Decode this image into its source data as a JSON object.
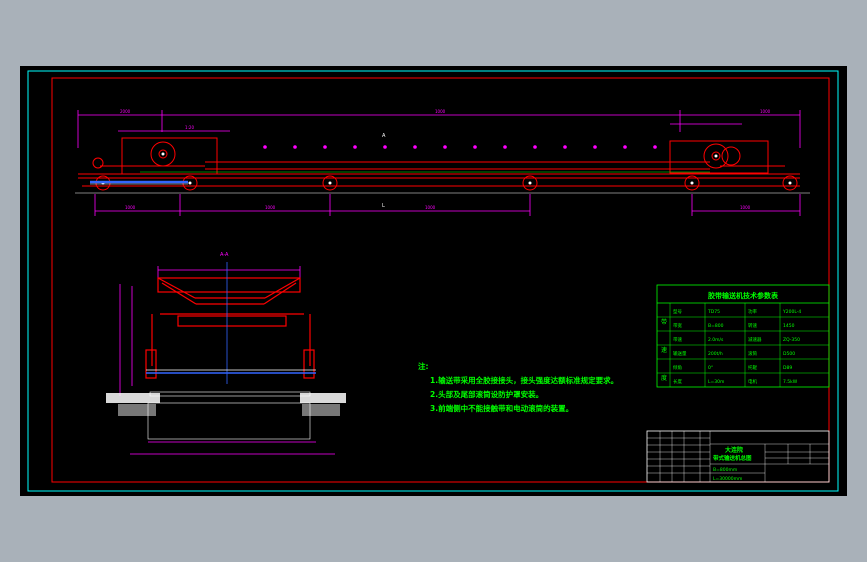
{
  "colors": {
    "background": "#000000",
    "page": "#a9b1b9",
    "border_cyan": "#00ffff",
    "border_red": "#ff0000",
    "green": "#00ff00",
    "magenta": "#ff00ff",
    "yellow": "#ffff00",
    "blue": "#3366ff",
    "white": "#ffffff"
  },
  "drawing": {
    "top_dims": [
      "2000",
      "1:20",
      "1000",
      "1000"
    ],
    "bottom_dims": [
      "1000",
      "1000",
      "1000",
      "1000"
    ],
    "label_a": "A",
    "label_l": "L",
    "section_title": "A-A"
  },
  "notes": {
    "heading": "注:",
    "items": [
      "1.输送带采用全胶接接头，接头强度达额标准规定要求。",
      "2.头部及尾部滚筒设防护罩安装。",
      "3.前端侧中不能接触带和电动滚筒的装置。"
    ]
  },
  "spec_table": {
    "title": "胶带输送机技术参数表",
    "side_labels": [
      "带",
      "速",
      "度"
    ],
    "rows": [
      [
        "型号",
        "TD75",
        "功率",
        "Y200L-4"
      ],
      [
        "带宽",
        "B=800",
        "转速",
        "1450"
      ],
      [
        "带速",
        "2.0m/s",
        "减速器",
        "ZQ-350"
      ],
      [
        "输送量",
        "200t/h",
        "滚筒",
        "D500"
      ],
      [
        "倾角",
        "0°",
        "托辊",
        "D89"
      ],
      [
        "长度",
        "L=30m",
        "电机",
        "7.5kW"
      ]
    ]
  },
  "title_block": {
    "company": "大连院",
    "drawing_name": "带式输送机总图",
    "spec_1": "B=800mm",
    "spec_2": "L=30000mm"
  }
}
